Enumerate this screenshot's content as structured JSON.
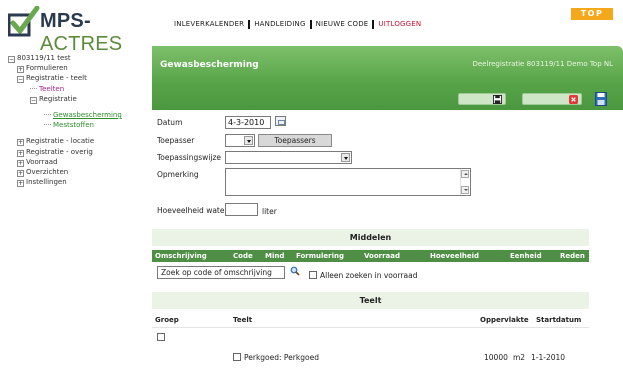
{
  "brand": {
    "name_part1": "MPS-",
    "name_part2": "ACTRES"
  },
  "topnav": [
    "INLEVERKALENDER",
    "HANDLEIDING",
    "NIEUWE CODE",
    "UITLOGGEN"
  ],
  "badge": "TOP",
  "sidebar": {
    "root": "803119/11 test",
    "items": [
      {
        "label": "Formulieren"
      },
      {
        "label": "Registratie - teelt"
      },
      {
        "label": "Teelten"
      },
      {
        "label": "Registratie"
      },
      {
        "label": "Gewasbescherming"
      },
      {
        "label": "Meststoffen"
      },
      {
        "label": "Registratie - locatie"
      },
      {
        "label": "Registratie - overig"
      },
      {
        "label": "Voorraad"
      },
      {
        "label": "Overzichten"
      },
      {
        "label": "Instellingen"
      }
    ]
  },
  "banner": {
    "title": "Gewasbescherming",
    "subtitle": "Deelregistratie 803119/11 Demo Top NL"
  },
  "form": {
    "datum_label": "Datum",
    "datum_value": "4-3-2010",
    "toepasser_label": "Toepasser",
    "toepassers_button": "Toepassers",
    "toepassingswijze_label": "Toepassingswijze",
    "opmerking_label": "Opmerking",
    "water_label": "Hoeveelheid water",
    "water_unit": "liter"
  },
  "middelen": {
    "title": "Middelen",
    "columns": [
      "Omschrijving",
      "Code",
      "Mind",
      "Formulering",
      "Voorraad",
      "Hoeveelheid",
      "Eenheid",
      "Reden"
    ],
    "search_placeholder": "Zoek op code of omschrijving",
    "only_stock_label": "Alleen zoeken in voorraad"
  },
  "teelt": {
    "title": "Teelt",
    "columns": [
      "Groep",
      "Teelt",
      "Oppervlakte",
      "Startdatum"
    ],
    "rows": [
      {
        "teelt": "Perkgoed: Perkgoed",
        "oppervlakte": "10000",
        "unit": "m2",
        "startdatum": "1-1-2010"
      }
    ]
  }
}
